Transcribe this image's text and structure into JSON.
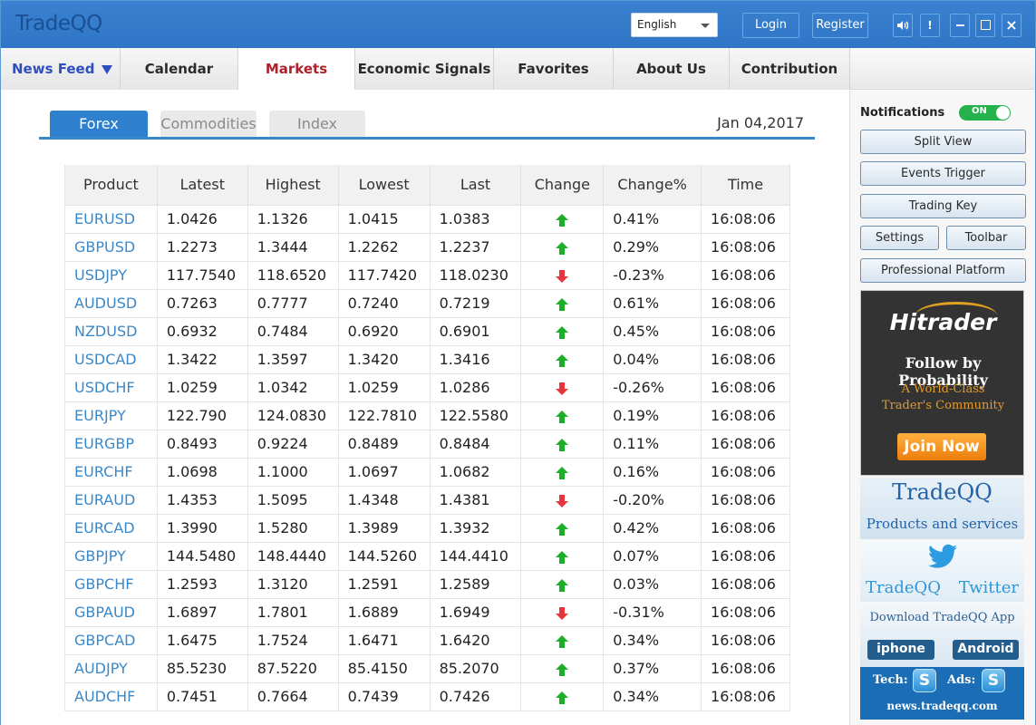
{
  "app": {
    "title": "TradeQQ",
    "language": "English",
    "login_label": "Login",
    "register_label": "Register",
    "window_controls": {
      "sound": "🔊",
      "alert": "!",
      "close": "×"
    }
  },
  "nav": {
    "items": [
      {
        "label": "News Feed"
      },
      {
        "label": "Calendar"
      },
      {
        "label": "Markets"
      },
      {
        "label": "Economic Signals"
      },
      {
        "label": "Favorites"
      },
      {
        "label": "About Us"
      },
      {
        "label": "Contribution"
      }
    ],
    "active": "Markets"
  },
  "markets": {
    "tabs": [
      {
        "label": "Forex"
      },
      {
        "label": "Commodities"
      },
      {
        "label": "Index"
      }
    ],
    "active_tab": "Forex",
    "date": "Jan 04,2017",
    "columns": [
      "Product",
      "Latest",
      "Highest",
      "Lowest",
      "Last",
      "Change",
      "Change%",
      "Time"
    ],
    "rows": [
      {
        "product": "EURUSD",
        "latest": "1.0426",
        "highest": "1.1326",
        "lowest": "1.0415",
        "last": "1.0383",
        "direction": "up",
        "change_pct": "0.41%",
        "time": "16:08:06"
      },
      {
        "product": "GBPUSD",
        "latest": "1.2273",
        "highest": "1.3444",
        "lowest": "1.2262",
        "last": "1.2237",
        "direction": "up",
        "change_pct": "0.29%",
        "time": "16:08:06"
      },
      {
        "product": "USDJPY",
        "latest": "117.7540",
        "highest": "118.6520",
        "lowest": "117.7420",
        "last": "118.0230",
        "direction": "down",
        "change_pct": "-0.23%",
        "time": "16:08:06"
      },
      {
        "product": "AUDUSD",
        "latest": "0.7263",
        "highest": "0.7777",
        "lowest": "0.7240",
        "last": "0.7219",
        "direction": "up",
        "change_pct": "0.61%",
        "time": "16:08:06"
      },
      {
        "product": "NZDUSD",
        "latest": "0.6932",
        "highest": "0.7484",
        "lowest": "0.6920",
        "last": "0.6901",
        "direction": "up",
        "change_pct": "0.45%",
        "time": "16:08:06"
      },
      {
        "product": "USDCAD",
        "latest": "1.3422",
        "highest": "1.3597",
        "lowest": "1.3420",
        "last": "1.3416",
        "direction": "up",
        "change_pct": "0.04%",
        "time": "16:08:06"
      },
      {
        "product": "USDCHF",
        "latest": "1.0259",
        "highest": "1.0342",
        "lowest": "1.0259",
        "last": "1.0286",
        "direction": "down",
        "change_pct": "-0.26%",
        "time": "16:08:06"
      },
      {
        "product": "EURJPY",
        "latest": "122.790",
        "highest": "124.0830",
        "lowest": "122.7810",
        "last": "122.5580",
        "direction": "up",
        "change_pct": "0.19%",
        "time": "16:08:06"
      },
      {
        "product": "EURGBP",
        "latest": "0.8493",
        "highest": "0.9224",
        "lowest": "0.8489",
        "last": "0.8484",
        "direction": "up",
        "change_pct": "0.11%",
        "time": "16:08:06"
      },
      {
        "product": "EURCHF",
        "latest": "1.0698",
        "highest": "1.1000",
        "lowest": "1.0697",
        "last": "1.0682",
        "direction": "up",
        "change_pct": "0.16%",
        "time": "16:08:06"
      },
      {
        "product": "EURAUD",
        "latest": "1.4353",
        "highest": "1.5095",
        "lowest": "1.4348",
        "last": "1.4381",
        "direction": "down",
        "change_pct": "-0.20%",
        "time": "16:08:06"
      },
      {
        "product": "EURCAD",
        "latest": "1.3990",
        "highest": "1.5280",
        "lowest": "1.3989",
        "last": "1.3932",
        "direction": "up",
        "change_pct": "0.42%",
        "time": "16:08:06"
      },
      {
        "product": "GBPJPY",
        "latest": "144.5480",
        "highest": "148.4440",
        "lowest": "144.5260",
        "last": "144.4410",
        "direction": "up",
        "change_pct": "0.07%",
        "time": "16:08:06"
      },
      {
        "product": "GBPCHF",
        "latest": "1.2593",
        "highest": "1.3120",
        "lowest": "1.2591",
        "last": "1.2589",
        "direction": "up",
        "change_pct": "0.03%",
        "time": "16:08:06"
      },
      {
        "product": "GBPAUD",
        "latest": "1.6897",
        "highest": "1.7801",
        "lowest": "1.6889",
        "last": "1.6949",
        "direction": "down",
        "change_pct": "-0.31%",
        "time": "16:08:06"
      },
      {
        "product": "GBPCAD",
        "latest": "1.6475",
        "highest": "1.7524",
        "lowest": "1.6471",
        "last": "1.6420",
        "direction": "up",
        "change_pct": "0.34%",
        "time": "16:08:06"
      },
      {
        "product": "AUDJPY",
        "latest": "85.5230",
        "highest": "87.5220",
        "lowest": "85.4150",
        "last": "85.2070",
        "direction": "up",
        "change_pct": "0.37%",
        "time": "16:08:06"
      },
      {
        "product": "AUDCHF",
        "latest": "0.7451",
        "highest": "0.7664",
        "lowest": "0.7439",
        "last": "0.7426",
        "direction": "up",
        "change_pct": "0.34%",
        "time": "16:08:06"
      }
    ]
  },
  "sidebar": {
    "notifications_label": "Notifications",
    "notifications_state": "ON",
    "buttons": {
      "split_view": "Split View",
      "events_trigger": "Events Trigger",
      "trading_key": "Trading Key",
      "settings": "Settings",
      "toolbar": "Toolbar",
      "professional_platform": "Professional Platform"
    },
    "ad_hitrader": {
      "logo": "Hitrader",
      "tagline": "Follow by Probability",
      "subline1": "A World-Class",
      "subline2": "Trader's Community",
      "cta": "Join Now"
    },
    "ad_products": {
      "title": "TradeQQ",
      "subtitle": "Products and services"
    },
    "ad_twitter": {
      "label": "TradeQQ Twitter"
    },
    "ad_download": {
      "title": "Download TradeQQ App",
      "iphone": "iphone",
      "android": "Android"
    },
    "contact": {
      "tech_label": "Tech:",
      "ads_label": "Ads:",
      "skype_glyph": "S",
      "url": "news.tradeqq.com"
    }
  },
  "colors": {
    "brand_blue": "#2f76c6",
    "active_nav": "#b0202c",
    "up": "#1cae26",
    "down": "#e8343c",
    "link": "#3b88c9"
  }
}
